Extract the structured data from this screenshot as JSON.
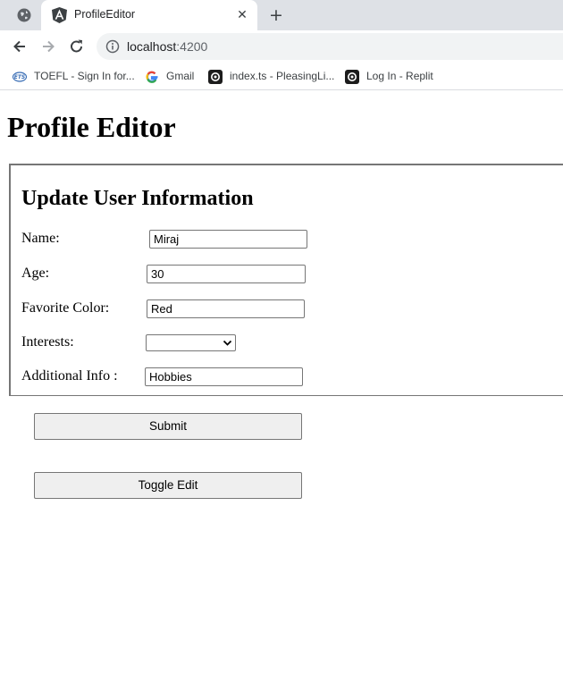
{
  "browser": {
    "tab_title": "ProfileEditor",
    "address": {
      "host": "localhost",
      "port": ":4200"
    },
    "bookmarks": [
      {
        "label": "TOEFL - Sign In for...",
        "icon": "ets-icon"
      },
      {
        "label": "Gmail",
        "icon": "google-icon"
      },
      {
        "label": "index.ts - PleasingLi...",
        "icon": "replit-icon"
      },
      {
        "label": "Log In - Replit",
        "icon": "replit-icon"
      }
    ]
  },
  "page": {
    "title": "Profile Editor",
    "form": {
      "title": "Update User Information",
      "fields": {
        "name": {
          "label": "Name:",
          "value": "Miraj"
        },
        "age": {
          "label": "Age:",
          "value": "30"
        },
        "color": {
          "label": "Favorite Color:",
          "value": "Red"
        },
        "interests": {
          "label": "Interests:",
          "value": ""
        },
        "info": {
          "label": "Additional Info :",
          "value": "Hobbies"
        }
      }
    },
    "buttons": {
      "submit": "Submit",
      "toggle": "Toggle Edit"
    }
  }
}
